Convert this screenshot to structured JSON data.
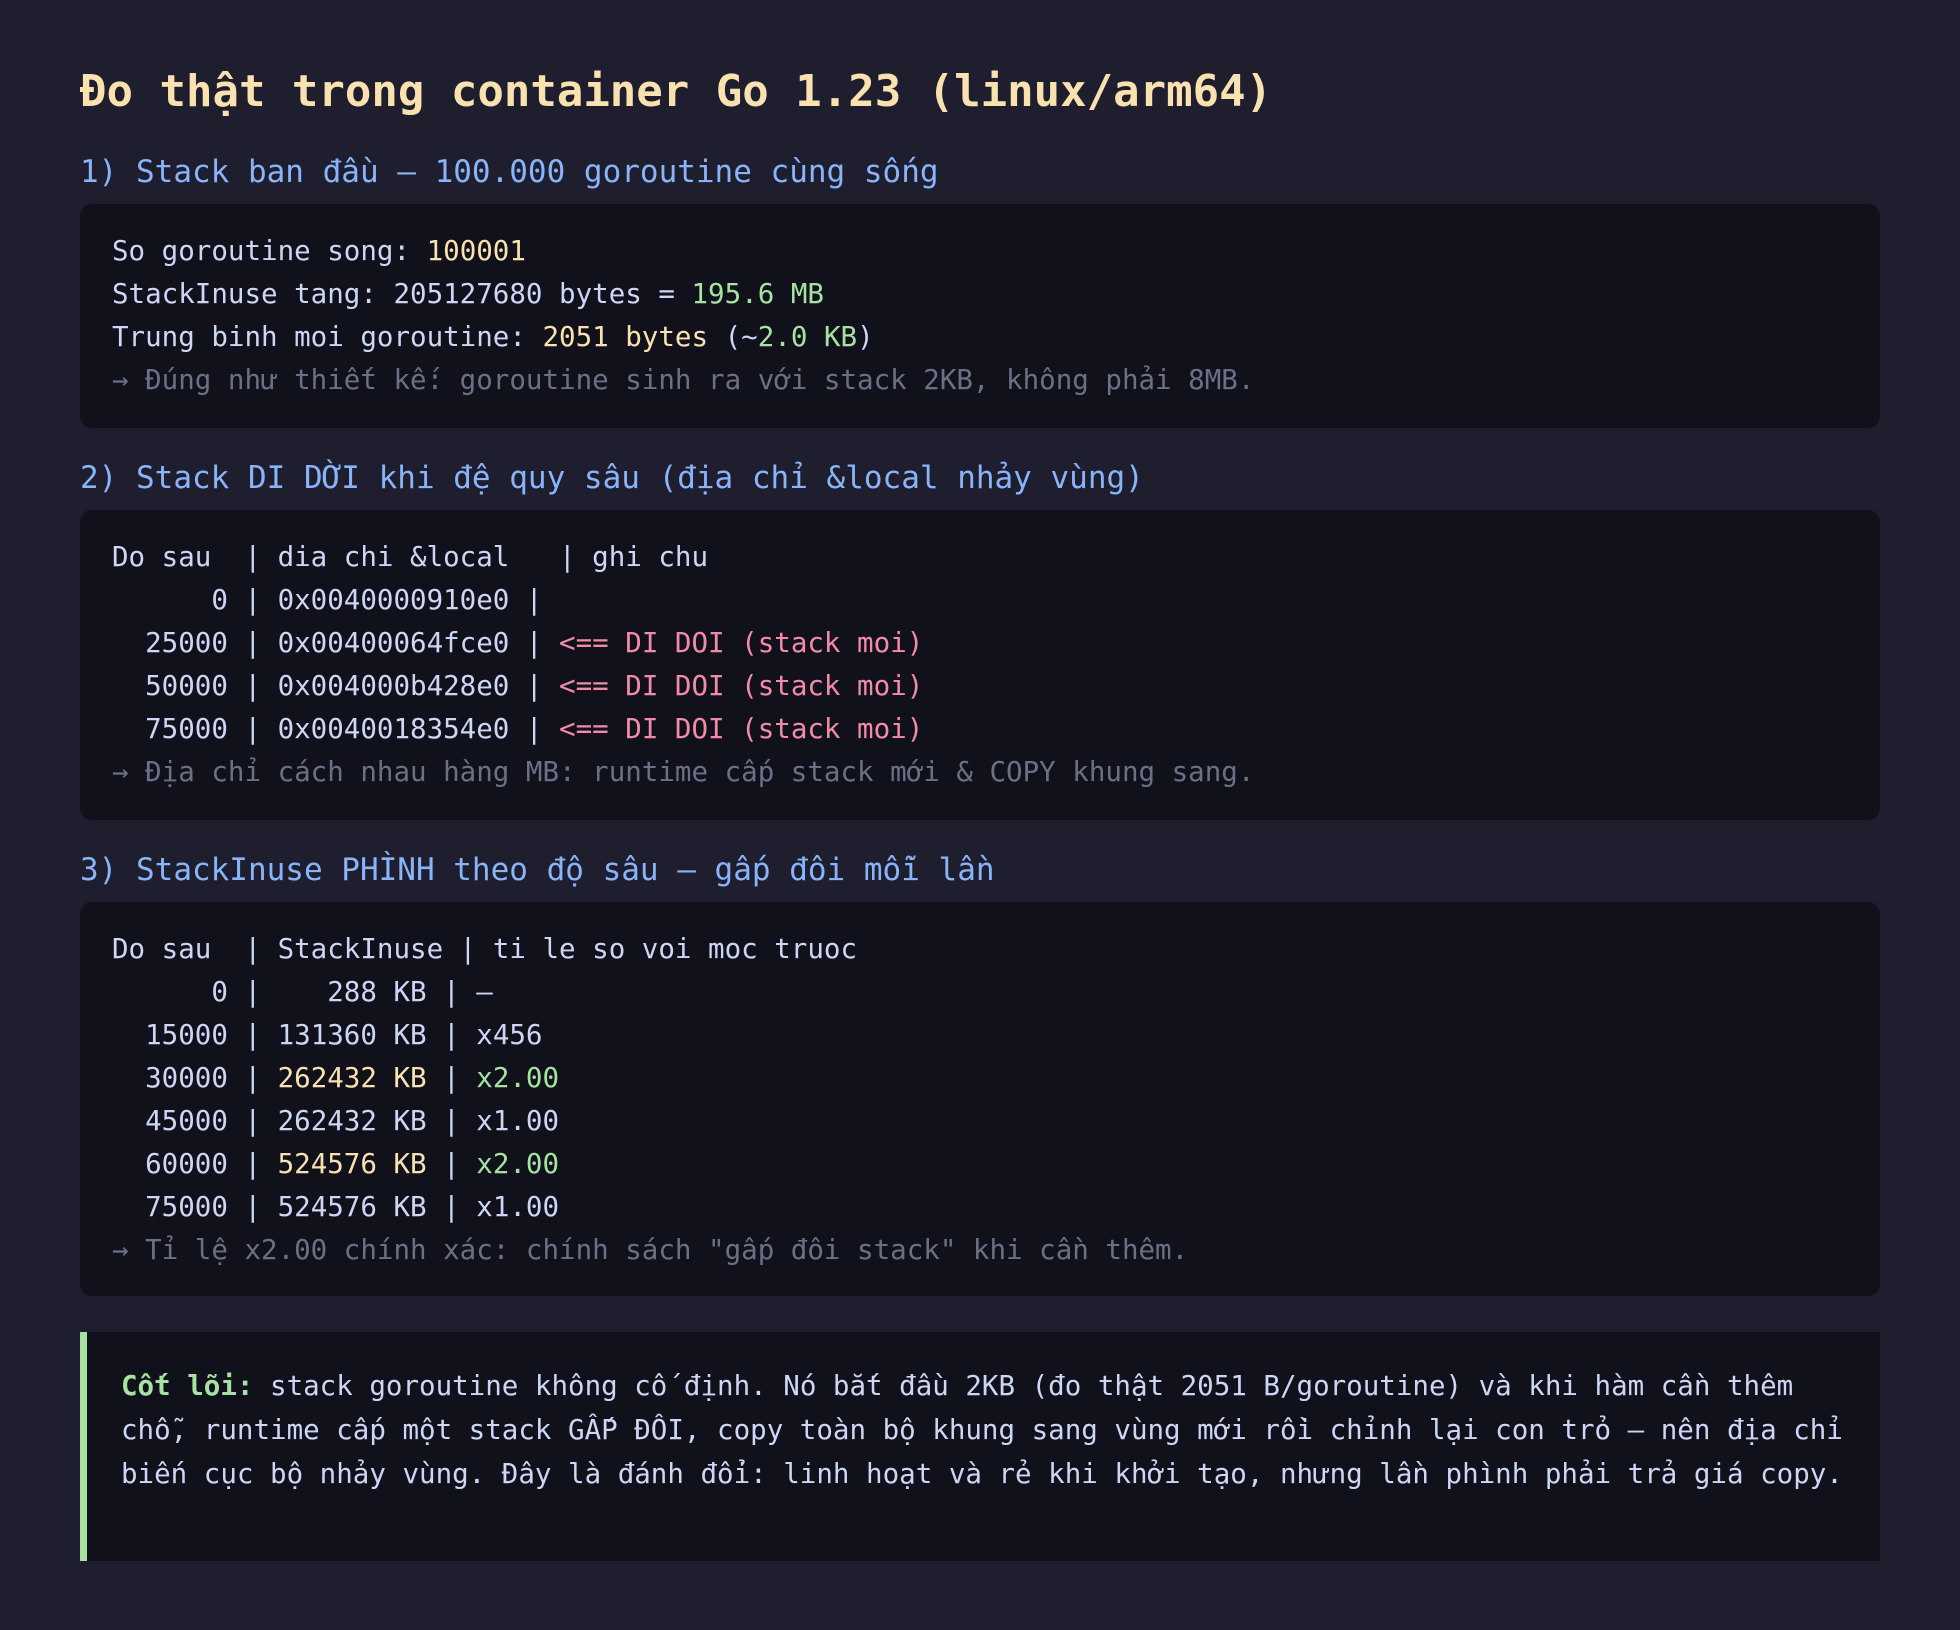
{
  "title": "Đo thật trong container Go 1.23 (linux/arm64)",
  "section1": {
    "heading": "1) Stack ban đầu — 100.000 goroutine cùng sống",
    "count_label": "So goroutine song: ",
    "count_value": "100001",
    "inuse_label": "StackInuse tang: 205127680 bytes = ",
    "inuse_value": "195.6 MB",
    "avg_label": "Trung binh moi goroutine: ",
    "avg_value": "2051 bytes",
    "avg_open": " (~",
    "avg_kb": "2.0 KB",
    "avg_close": ")",
    "note": "→ Đúng như thiết kế: goroutine sinh ra với stack 2KB, không phải 8MB."
  },
  "section2": {
    "heading": "2) Stack DI DỜI khi đệ quy sâu (địa chỉ &local nhảy vùng)",
    "header": "Do sau  | dia chi &local   | ghi chu",
    "rows": [
      {
        "left": "      0 | 0x0040000910e0 |",
        "flag": ""
      },
      {
        "left": "  25000 | 0x00400064fce0 | ",
        "flag": "<== DI DOI (stack moi)"
      },
      {
        "left": "  50000 | 0x004000b428e0 | ",
        "flag": "<== DI DOI (stack moi)"
      },
      {
        "left": "  75000 | 0x0040018354e0 | ",
        "flag": "<== DI DOI (stack moi)"
      }
    ],
    "note": "→ Địa chỉ cách nhau hàng MB: runtime cấp stack mới & COPY khung sang."
  },
  "section3": {
    "heading": "3) StackInuse PHÌNH theo độ sâu — gấp đôi mỗi lần",
    "header": "Do sau  | StackInuse | ti le so voi moc truoc",
    "rows": [
      {
        "depth": "      0",
        "inuse": "   288 KB",
        "ratio": "–",
        "highlight": false
      },
      {
        "depth": "  15000",
        "inuse": "131360 KB",
        "ratio": "x456",
        "highlight": false
      },
      {
        "depth": "  30000",
        "inuse": "262432 KB",
        "ratio": "x2.00",
        "highlight": true
      },
      {
        "depth": "  45000",
        "inuse": "262432 KB",
        "ratio": "x1.00",
        "highlight": false
      },
      {
        "depth": "  60000",
        "inuse": "524576 KB",
        "ratio": "x2.00",
        "highlight": true
      },
      {
        "depth": "  75000",
        "inuse": "524576 KB",
        "ratio": "x1.00",
        "highlight": false
      }
    ],
    "note": "→ Tỉ lệ x2.00 chính xác: chính sách \"gấp đôi stack\" khi cần thêm."
  },
  "core": {
    "label": "Cốt lõi:",
    "text": " stack goroutine không cố định. Nó bắt đầu 2KB (đo thật 2051 B/goroutine) và khi hàm cần thêm chỗ, runtime cấp một stack GẤP ĐÔI, copy toàn bộ khung sang vùng mới rồi chỉnh lại con trỏ — nên địa chỉ biến cục bộ nhảy vùng. Đây là đánh đổi: linh hoạt và rẻ khi khởi tạo, nhưng lần phình phải trả giá copy."
  }
}
